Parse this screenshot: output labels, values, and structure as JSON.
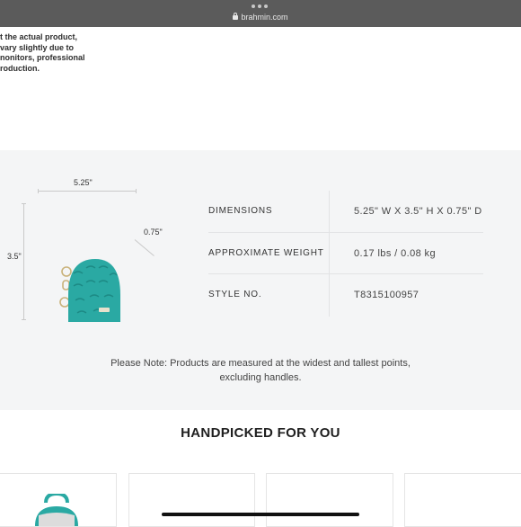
{
  "browser": {
    "url": "brahmin.com"
  },
  "disclaimer": {
    "lines": [
      "t the actual product,",
      "vary slightly due to",
      "nonitors, professional",
      "roduction."
    ]
  },
  "dimensions_diagram": {
    "width": "5.25\"",
    "height": "3.5\"",
    "depth": "0.75\""
  },
  "specs": [
    {
      "label": "DIMENSIONS",
      "value": "5.25\" W X 3.5\" H X 0.75\" D"
    },
    {
      "label": "APPROXIMATE WEIGHT",
      "value": "0.17 lbs / 0.08 kg"
    },
    {
      "label": "STYLE NO.",
      "value": "T8315100957"
    }
  ],
  "note": "Please Note: Products are measured at the widest and tallest points, excluding handles.",
  "handpicked": {
    "title": "HANDPICKED FOR YOU"
  },
  "colors": {
    "product_teal": "#2aa9a3",
    "section_bg": "#f4f5f6"
  }
}
